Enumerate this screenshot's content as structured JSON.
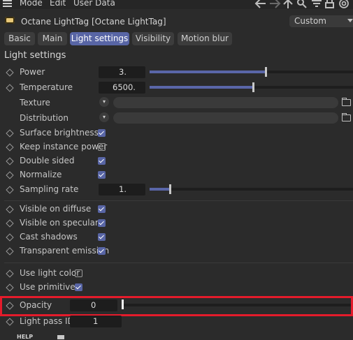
{
  "menubar": {
    "items": [
      "Mode",
      "Edit",
      "User Data"
    ]
  },
  "header": {
    "title": "Octane LightTag [Octane LightTag]",
    "preset": "Custom"
  },
  "tabs": [
    {
      "label": "Basic",
      "active": false
    },
    {
      "label": "Main",
      "active": false
    },
    {
      "label": "Light settings",
      "active": true
    },
    {
      "label": "Visibility",
      "active": false
    },
    {
      "label": "Motion blur",
      "active": false
    }
  ],
  "section": {
    "title": "Light settings"
  },
  "params": {
    "power": {
      "label": "Power",
      "value": "3.",
      "slider_fraction": 0.57
    },
    "temperature": {
      "label": "Temperature",
      "value": "6500.",
      "slider_fraction": 0.51
    },
    "texture": {
      "label": "Texture"
    },
    "distribution": {
      "label": "Distribution"
    },
    "surface_brightness": {
      "label": "Surface brightness",
      "checked": true
    },
    "keep_instance_power": {
      "label": "Keep instance power",
      "checked": false
    },
    "double_sided": {
      "label": "Double sided",
      "checked": true
    },
    "normalize": {
      "label": "Normalize",
      "checked": true
    },
    "sampling_rate": {
      "label": "Sampling rate",
      "value": "1.",
      "slider_fraction": 0.1
    },
    "visible_on_diffuse": {
      "label": "Visible on diffuse",
      "checked": true
    },
    "visible_on_specular": {
      "label": "Visible on specular",
      "checked": true
    },
    "cast_shadows": {
      "label": "Cast shadows",
      "checked": true
    },
    "transparent_emission": {
      "label": "Transparent emission",
      "checked": true
    },
    "use_light_color": {
      "label": "Use light color",
      "checked": false
    },
    "use_primitives": {
      "label": "Use primitives",
      "checked": true
    },
    "opacity": {
      "label": "Opacity",
      "value": "0",
      "slider_fraction": 0.0
    },
    "light_pass_id": {
      "label": "Light pass ID",
      "value": "1"
    }
  },
  "footer": {
    "help_label": "HELP"
  },
  "colors": {
    "accent": "#5865a5",
    "highlight": "#e41b2b",
    "background": "#2b2b2b"
  },
  "icons": [
    "menu-icon",
    "back-arrow-icon",
    "forward-arrow-icon",
    "up-arrow-icon",
    "search-icon",
    "filter-icon",
    "lock-icon",
    "target-icon",
    "chevron-down-icon",
    "folder-icon"
  ]
}
